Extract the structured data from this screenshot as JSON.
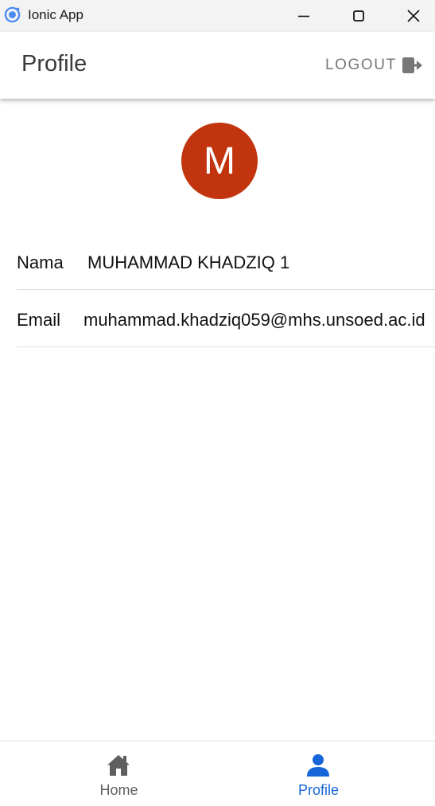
{
  "window": {
    "title": "Ionic App"
  },
  "header": {
    "title": "Profile",
    "logout_label": "LOGOUT"
  },
  "profile": {
    "avatar_initial": "M",
    "fields": [
      {
        "label": "Nama",
        "value": "MUHAMMAD KHADZIQ 1"
      },
      {
        "label": "Email",
        "value": "muhammad.khadziq059@mhs.unsoed.ac.id"
      }
    ]
  },
  "tabs": [
    {
      "label": "Home",
      "icon": "home-icon",
      "active": false
    },
    {
      "label": "Profile",
      "icon": "person-icon",
      "active": true
    }
  ],
  "colors": {
    "accent": "#1565d8",
    "avatar": "#c1340e",
    "inactive_tab": "#5f5f5f",
    "logout": "#777777"
  }
}
